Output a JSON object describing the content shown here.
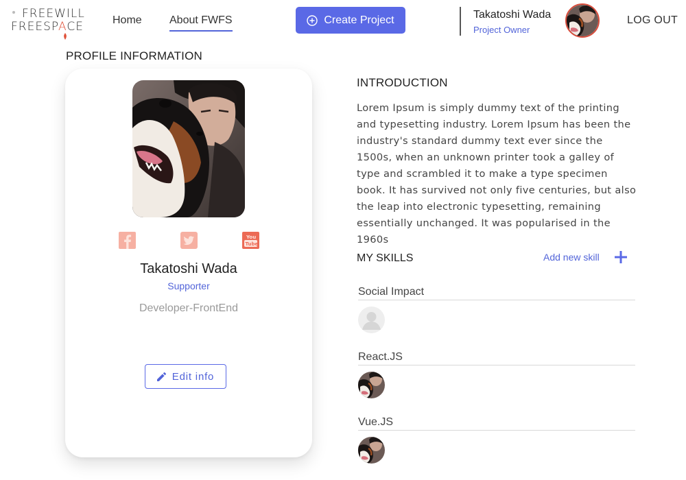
{
  "header": {
    "logo": {
      "line1": "FREEWILL",
      "line2_left": "FREESP",
      "line2_accent": "A",
      "line2_right": "CE"
    },
    "nav": [
      {
        "label": "Home",
        "active": false
      },
      {
        "label": "About FWFS",
        "active": true
      }
    ],
    "create_button": {
      "label": "Create Project",
      "icon": "plus-circle-icon"
    },
    "user": {
      "name": "Takatoshi Wada",
      "role": "Project Owner"
    },
    "logout_label": "LOG OUT"
  },
  "profile": {
    "section_title": "PROFILE INFORMATION",
    "name": "Takatoshi Wada",
    "role": "Supporter",
    "title": "Developer-FrontEnd",
    "social": [
      "facebook-icon",
      "twitter-icon",
      "youtube-icon"
    ],
    "edit_button": {
      "label": "Edit info",
      "icon": "pencil-icon"
    }
  },
  "introduction": {
    "title": "INTRODUCTION",
    "text": "Lorem Ipsum is simply dummy text of the printing and typesetting industry. Lorem Ipsum has been the industry's standard dummy text ever since the 1500s, when an unknown printer took a galley of type and scrambled it to make a type specimen book. It has survived not only five centuries, but also the leap into electronic typesetting, remaining essentially unchanged. It was popularised in the 1960s"
  },
  "skills": {
    "title": "MY SKILLS",
    "add_label": "Add new skill",
    "items": [
      {
        "name": "Social Impact",
        "avatar": "placeholder"
      },
      {
        "name": "React.JS",
        "avatar": "photo"
      },
      {
        "name": "Vue.JS",
        "avatar": "photo"
      }
    ]
  },
  "colors": {
    "accent": "#5a69e6",
    "link": "#5264d9",
    "avatar_ring": "#d94b3a",
    "social": "#f4a090"
  }
}
